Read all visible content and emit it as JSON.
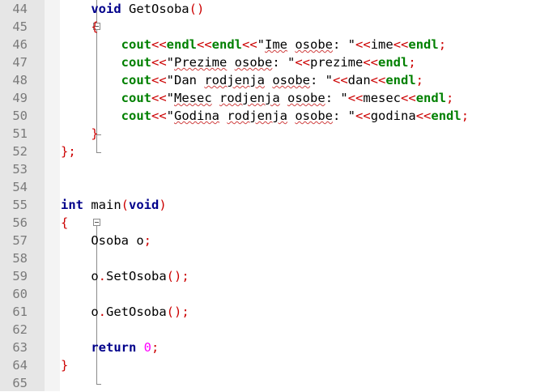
{
  "editor": {
    "lines": [
      {
        "num": "44",
        "tokens": [
          {
            "t": "    "
          },
          {
            "t": "void",
            "c": "kw"
          },
          {
            "t": " GetOsoba"
          },
          {
            "t": "()",
            "c": "op"
          }
        ]
      },
      {
        "num": "45",
        "tokens": [
          {
            "t": "    "
          },
          {
            "t": "{",
            "c": "op"
          }
        ]
      },
      {
        "num": "46",
        "tokens": [
          {
            "t": "        "
          },
          {
            "t": "cout",
            "c": "kwg"
          },
          {
            "t": "<<",
            "c": "op"
          },
          {
            "t": "endl",
            "c": "kwg"
          },
          {
            "t": "<<",
            "c": "op"
          },
          {
            "t": "endl",
            "c": "kwg"
          },
          {
            "t": "<<",
            "c": "op"
          },
          {
            "t": "\""
          },
          {
            "t": "Ime",
            "c": "sq"
          },
          {
            "t": " "
          },
          {
            "t": "osobe",
            "c": "sq"
          },
          {
            "t": ": \""
          },
          {
            "t": "<<",
            "c": "op"
          },
          {
            "t": "ime"
          },
          {
            "t": "<<",
            "c": "op"
          },
          {
            "t": "endl",
            "c": "kwg"
          },
          {
            "t": ";",
            "c": "op"
          }
        ]
      },
      {
        "num": "47",
        "tokens": [
          {
            "t": "        "
          },
          {
            "t": "cout",
            "c": "kwg"
          },
          {
            "t": "<<",
            "c": "op"
          },
          {
            "t": "\""
          },
          {
            "t": "Prezime",
            "c": "sq"
          },
          {
            "t": " "
          },
          {
            "t": "osobe",
            "c": "sq"
          },
          {
            "t": ": \""
          },
          {
            "t": "<<",
            "c": "op"
          },
          {
            "t": "prezime"
          },
          {
            "t": "<<",
            "c": "op"
          },
          {
            "t": "endl",
            "c": "kwg"
          },
          {
            "t": ";",
            "c": "op"
          }
        ]
      },
      {
        "num": "48",
        "tokens": [
          {
            "t": "        "
          },
          {
            "t": "cout",
            "c": "kwg"
          },
          {
            "t": "<<",
            "c": "op"
          },
          {
            "t": "\"Dan "
          },
          {
            "t": "rodjenja",
            "c": "sq"
          },
          {
            "t": " "
          },
          {
            "t": "osobe",
            "c": "sq"
          },
          {
            "t": ": \""
          },
          {
            "t": "<<",
            "c": "op"
          },
          {
            "t": "dan"
          },
          {
            "t": "<<",
            "c": "op"
          },
          {
            "t": "endl",
            "c": "kwg"
          },
          {
            "t": ";",
            "c": "op"
          }
        ]
      },
      {
        "num": "49",
        "tokens": [
          {
            "t": "        "
          },
          {
            "t": "cout",
            "c": "kwg"
          },
          {
            "t": "<<",
            "c": "op"
          },
          {
            "t": "\""
          },
          {
            "t": "Mesec",
            "c": "sq"
          },
          {
            "t": " "
          },
          {
            "t": "rodjenja",
            "c": "sq"
          },
          {
            "t": " "
          },
          {
            "t": "osobe",
            "c": "sq"
          },
          {
            "t": ": \""
          },
          {
            "t": "<<",
            "c": "op"
          },
          {
            "t": "mesec"
          },
          {
            "t": "<<",
            "c": "op"
          },
          {
            "t": "endl",
            "c": "kwg"
          },
          {
            "t": ";",
            "c": "op"
          }
        ]
      },
      {
        "num": "50",
        "tokens": [
          {
            "t": "        "
          },
          {
            "t": "cout",
            "c": "kwg"
          },
          {
            "t": "<<",
            "c": "op"
          },
          {
            "t": "\""
          },
          {
            "t": "Godina",
            "c": "sq"
          },
          {
            "t": " "
          },
          {
            "t": "rodjenja",
            "c": "sq"
          },
          {
            "t": " "
          },
          {
            "t": "osobe",
            "c": "sq"
          },
          {
            "t": ": \""
          },
          {
            "t": "<<",
            "c": "op"
          },
          {
            "t": "godina"
          },
          {
            "t": "<<",
            "c": "op"
          },
          {
            "t": "endl",
            "c": "kwg"
          },
          {
            "t": ";",
            "c": "op"
          }
        ]
      },
      {
        "num": "51",
        "tokens": [
          {
            "t": "    "
          },
          {
            "t": "}",
            "c": "op"
          }
        ]
      },
      {
        "num": "52",
        "tokens": [
          {
            "t": "};",
            "c": "op"
          }
        ]
      },
      {
        "num": "53",
        "tokens": []
      },
      {
        "num": "54",
        "tokens": []
      },
      {
        "num": "55",
        "tokens": [
          {
            "t": "int",
            "c": "kw"
          },
          {
            "t": " main"
          },
          {
            "t": "(",
            "c": "op"
          },
          {
            "t": "void",
            "c": "kw"
          },
          {
            "t": ")",
            "c": "op"
          }
        ]
      },
      {
        "num": "56",
        "tokens": [
          {
            "t": "{",
            "c": "op"
          }
        ]
      },
      {
        "num": "57",
        "tokens": [
          {
            "t": "    Osoba o"
          },
          {
            "t": ";",
            "c": "op"
          }
        ]
      },
      {
        "num": "58",
        "tokens": []
      },
      {
        "num": "59",
        "tokens": [
          {
            "t": "    o"
          },
          {
            "t": ".",
            "c": "op"
          },
          {
            "t": "SetOsoba"
          },
          {
            "t": "();",
            "c": "op"
          }
        ]
      },
      {
        "num": "60",
        "tokens": []
      },
      {
        "num": "61",
        "tokens": [
          {
            "t": "    o"
          },
          {
            "t": ".",
            "c": "op"
          },
          {
            "t": "GetOsoba"
          },
          {
            "t": "();",
            "c": "op"
          }
        ]
      },
      {
        "num": "62",
        "tokens": []
      },
      {
        "num": "63",
        "tokens": [
          {
            "t": "    "
          },
          {
            "t": "return",
            "c": "kw"
          },
          {
            "t": " "
          },
          {
            "t": "0",
            "c": "num"
          },
          {
            "t": ";",
            "c": "op"
          }
        ]
      },
      {
        "num": "64",
        "tokens": [
          {
            "t": "}",
            "c": "op"
          }
        ]
      },
      {
        "num": "65",
        "tokens": []
      }
    ]
  }
}
